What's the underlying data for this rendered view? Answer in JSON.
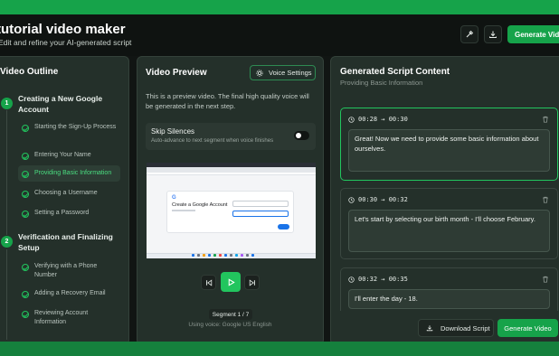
{
  "app": {
    "title": "tutorial video maker",
    "subtitle": "Edit and refine your AI-generated script"
  },
  "toolbar": {
    "generate_label": "Generate Video",
    "icons": [
      "wand-icon",
      "download-icon"
    ]
  },
  "outline": {
    "title": "Video Outline",
    "sections": [
      {
        "number": "1",
        "title": "Creating a New Google Account",
        "steps": [
          {
            "label": "Starting the Sign-Up Process",
            "active": false
          },
          {
            "label": "Entering Your Name",
            "active": false
          },
          {
            "label": "Providing Basic Information",
            "active": true
          },
          {
            "label": "Choosing a Username",
            "active": false
          },
          {
            "label": "Setting a Password",
            "active": false
          }
        ]
      },
      {
        "number": "2",
        "title": "Verification and Finalizing Setup",
        "steps": [
          {
            "label": "Verifying with a Phone Number",
            "active": false
          },
          {
            "label": "Adding a Recovery Email",
            "active": false
          },
          {
            "label": "Reviewing Account Information",
            "active": false
          }
        ]
      }
    ]
  },
  "preview": {
    "title": "Video Preview",
    "voice_settings_label": "Voice Settings",
    "description": "This is a preview video. The final high quality voice will be generated in the next step.",
    "skip_title": "Skip Silences",
    "skip_subtitle": "Auto-advance to next segment when voice finishes",
    "skip_enabled": false,
    "video_card_logo": "G",
    "video_card_title": "Create a Google Account",
    "segment_label": "Segment 1 / 7",
    "voice_info": "Using voice: Google US English"
  },
  "script": {
    "title": "Generated Script Content",
    "subtitle": "Providing Basic Information",
    "segments": [
      {
        "time": "00:28 → 00:30",
        "text": "Great! Now we need to provide some basic information about ourselves.",
        "active": true
      },
      {
        "time": "00:30 → 00:32",
        "text": "Let's start by selecting our birth month - I'll choose February.",
        "active": false
      },
      {
        "time": "00:32 → 00:35",
        "text": "I'll enter the day - 18.",
        "active": false
      }
    ],
    "download_label": "Download Script",
    "generate_label": "Generate Video"
  },
  "colors": {
    "accent": "#16a34a",
    "accent_light": "#4ade80",
    "panel": "#24302a",
    "background": "#111513"
  }
}
